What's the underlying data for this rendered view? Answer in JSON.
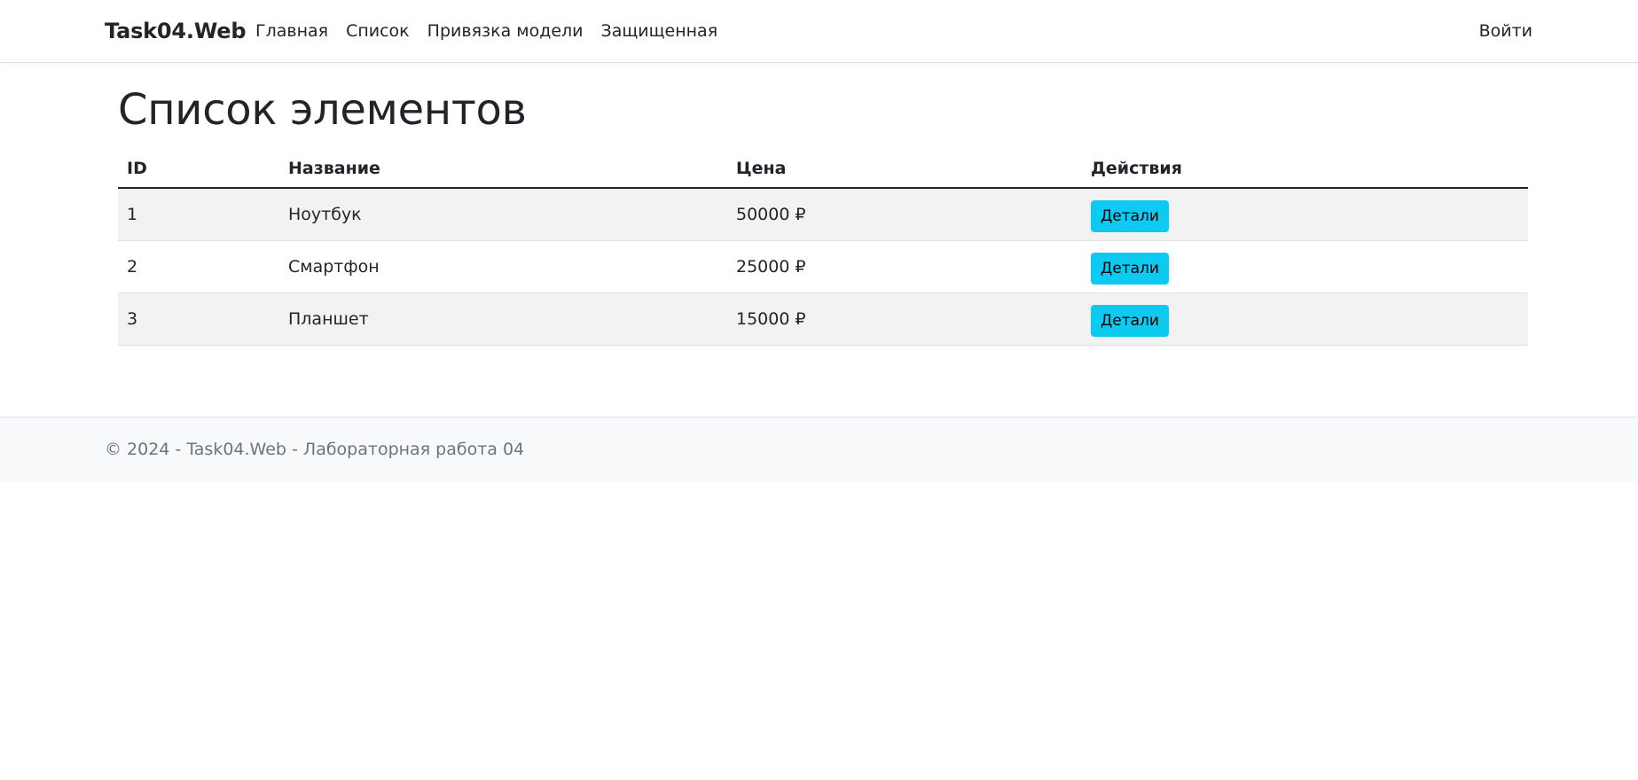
{
  "navbar": {
    "brand": "Task04.Web",
    "links": [
      {
        "label": "Главная"
      },
      {
        "label": "Список"
      },
      {
        "label": "Привязка модели"
      },
      {
        "label": "Защищенная"
      }
    ],
    "login": "Войти"
  },
  "main": {
    "title": "Список элементов",
    "table": {
      "headers": [
        "ID",
        "Название",
        "Цена",
        "Действия"
      ],
      "rows": [
        {
          "id": "1",
          "name": "Ноутбук",
          "price": "50000 ₽",
          "action": "Детали"
        },
        {
          "id": "2",
          "name": "Смартфон",
          "price": "25000 ₽",
          "action": "Детали"
        },
        {
          "id": "3",
          "name": "Планшет",
          "price": "15000 ₽",
          "action": "Детали"
        }
      ]
    }
  },
  "footer": {
    "text": "© 2024 - Task04.Web - Лабораторная работа 04"
  },
  "colors": {
    "button_bg": "#0dcaf0",
    "stripe": "#f2f2f2",
    "footer_bg": "#f8f9fa",
    "footer_text": "#6c757d"
  }
}
